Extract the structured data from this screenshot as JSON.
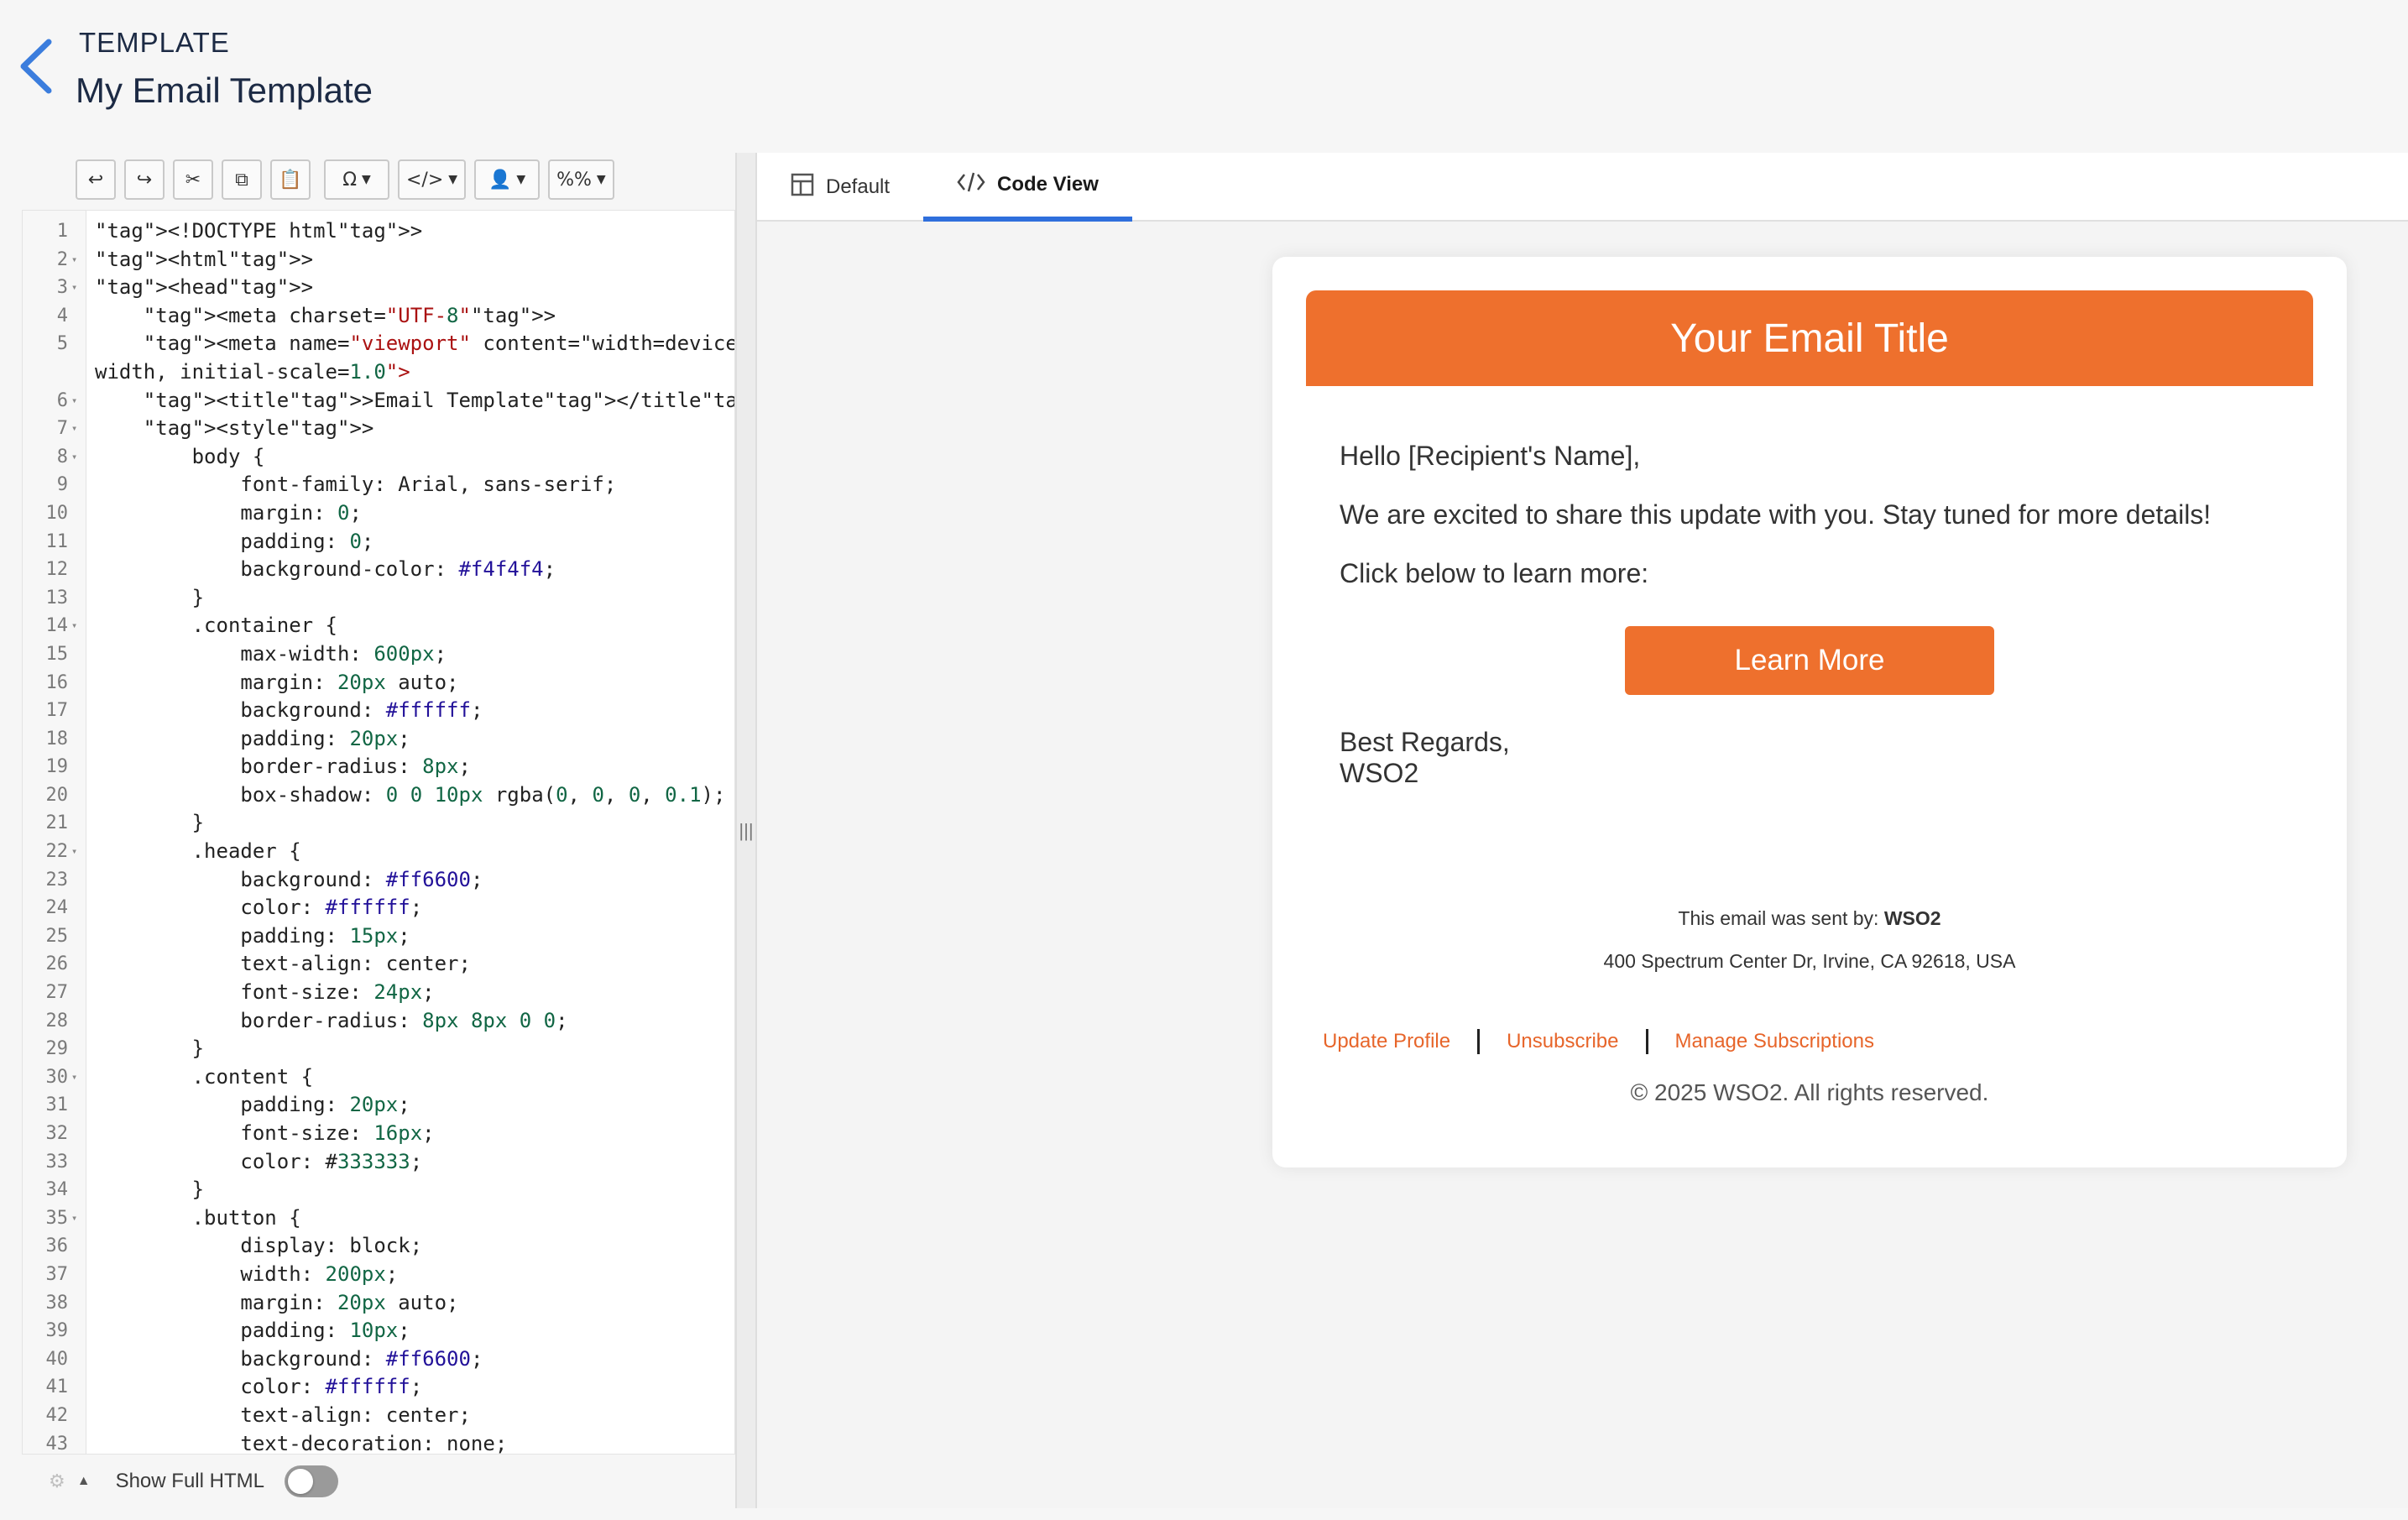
{
  "header": {
    "label": "TEMPLATE",
    "title": "My Email Template"
  },
  "toolbar": {
    "undo": "↩",
    "redo": "↪",
    "cut": "✂",
    "copy": "⧉",
    "paste": "📋",
    "special_chars": "Ω",
    "code": "</>",
    "user": "👤",
    "placeholder": "%%"
  },
  "editor": {
    "footer_label": "Show Full HTML",
    "lines": [
      {
        "n": "1",
        "fold": "",
        "t": "<!DOCTYPE html>"
      },
      {
        "n": "2",
        "fold": "▾",
        "t": "<html>"
      },
      {
        "n": "3",
        "fold": "▾",
        "t": "<head>"
      },
      {
        "n": "4",
        "fold": "",
        "t": "    <meta charset=\"UTF-8\">"
      },
      {
        "n": "5",
        "fold": "",
        "t": "    <meta name=\"viewport\" content=\"width=device-"
      },
      {
        "n": "",
        "fold": "",
        "t": "width, initial-scale=1.0\">"
      },
      {
        "n": "6",
        "fold": "▾",
        "t": "    <title>Email Template</title>"
      },
      {
        "n": "7",
        "fold": "▾",
        "t": "    <style>"
      },
      {
        "n": "8",
        "fold": "▾",
        "t": "        body {"
      },
      {
        "n": "9",
        "fold": "",
        "t": "            font-family: Arial, sans-serif;"
      },
      {
        "n": "10",
        "fold": "",
        "t": "            margin: 0;"
      },
      {
        "n": "11",
        "fold": "",
        "t": "            padding: 0;"
      },
      {
        "n": "12",
        "fold": "",
        "t": "            background-color: #f4f4f4;"
      },
      {
        "n": "13",
        "fold": "",
        "t": "        }"
      },
      {
        "n": "14",
        "fold": "▾",
        "t": "        .container {"
      },
      {
        "n": "15",
        "fold": "",
        "t": "            max-width: 600px;"
      },
      {
        "n": "16",
        "fold": "",
        "t": "            margin: 20px auto;"
      },
      {
        "n": "17",
        "fold": "",
        "t": "            background: #ffffff;"
      },
      {
        "n": "18",
        "fold": "",
        "t": "            padding: 20px;"
      },
      {
        "n": "19",
        "fold": "",
        "t": "            border-radius: 8px;"
      },
      {
        "n": "20",
        "fold": "",
        "t": "            box-shadow: 0 0 10px rgba(0, 0, 0, 0.1);"
      },
      {
        "n": "21",
        "fold": "",
        "t": "        }"
      },
      {
        "n": "22",
        "fold": "▾",
        "t": "        .header {"
      },
      {
        "n": "23",
        "fold": "",
        "t": "            background: #ff6600;"
      },
      {
        "n": "24",
        "fold": "",
        "t": "            color: #ffffff;"
      },
      {
        "n": "25",
        "fold": "",
        "t": "            padding: 15px;"
      },
      {
        "n": "26",
        "fold": "",
        "t": "            text-align: center;"
      },
      {
        "n": "27",
        "fold": "",
        "t": "            font-size: 24px;"
      },
      {
        "n": "28",
        "fold": "",
        "t": "            border-radius: 8px 8px 0 0;"
      },
      {
        "n": "29",
        "fold": "",
        "t": "        }"
      },
      {
        "n": "30",
        "fold": "▾",
        "t": "        .content {"
      },
      {
        "n": "31",
        "fold": "",
        "t": "            padding: 20px;"
      },
      {
        "n": "32",
        "fold": "",
        "t": "            font-size: 16px;"
      },
      {
        "n": "33",
        "fold": "",
        "t": "            color: #333333;"
      },
      {
        "n": "34",
        "fold": "",
        "t": "        }"
      },
      {
        "n": "35",
        "fold": "▾",
        "t": "        .button {"
      },
      {
        "n": "36",
        "fold": "",
        "t": "            display: block;"
      },
      {
        "n": "37",
        "fold": "",
        "t": "            width: 200px;"
      },
      {
        "n": "38",
        "fold": "",
        "t": "            margin: 20px auto;"
      },
      {
        "n": "39",
        "fold": "",
        "t": "            padding: 10px;"
      },
      {
        "n": "40",
        "fold": "",
        "t": "            background: #ff6600;"
      },
      {
        "n": "41",
        "fold": "",
        "t": "            color: #ffffff;"
      },
      {
        "n": "42",
        "fold": "",
        "t": "            text-align: center;"
      },
      {
        "n": "43",
        "fold": "",
        "t": "            text-decoration: none;"
      }
    ]
  },
  "tabs": [
    {
      "label": "Default",
      "icon": "layout-icon"
    },
    {
      "label": "Code View",
      "icon": "code-icon"
    }
  ],
  "email": {
    "title": "Your Email Title",
    "greeting": "Hello [Recipient's Name],",
    "body1": "We are excited to share this update with you. Stay tuned for more details!",
    "body2": "Click below to learn more:",
    "button": "Learn More",
    "sign1": "Best Regards,",
    "sign2": "WSO2",
    "sent_by_prefix": "This email was sent by: ",
    "sent_by_name": "WSO2",
    "address": "400 Spectrum Center Dr, Irvine, CA 92618, USA",
    "links": [
      "Update Profile",
      "Unsubscribe",
      "Manage Subscriptions"
    ],
    "copyright": "© 2025 WSO2. All rights reserved."
  },
  "colors": {
    "accent": "#ee702d",
    "tab_active": "#2f6fdc",
    "link": "#e7652a"
  }
}
